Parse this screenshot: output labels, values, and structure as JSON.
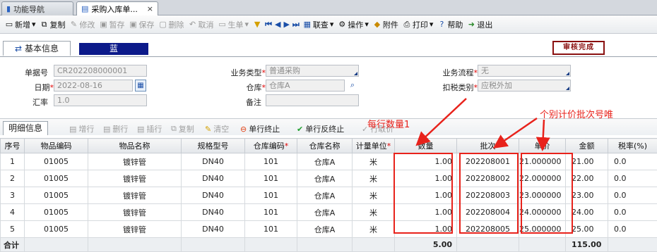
{
  "tabs": [
    {
      "label": "功能导航",
      "active": false
    },
    {
      "label": "采购入库单...",
      "active": true,
      "close": "×"
    }
  ],
  "toolbar": {
    "items": [
      {
        "label": "新增",
        "icon": "new-doc-icon",
        "enabled": true,
        "dropdown": true
      },
      {
        "label": "复制",
        "icon": "copy-icon",
        "enabled": true
      },
      {
        "label": "修改",
        "icon": "edit-icon",
        "enabled": false
      },
      {
        "label": "暂存",
        "icon": "save-draft-icon",
        "enabled": false
      },
      {
        "label": "保存",
        "icon": "save-icon",
        "enabled": false
      },
      {
        "label": "删除",
        "icon": "delete-icon",
        "enabled": false
      },
      {
        "label": "取消",
        "icon": "undo-icon",
        "enabled": false
      },
      {
        "label": "生单",
        "icon": "generate-doc-icon",
        "enabled": false,
        "dropdown": true
      }
    ],
    "right_items": [
      {
        "label": "联查",
        "icon": "link-query-icon",
        "dropdown": true
      },
      {
        "label": "操作",
        "icon": "gear-icon",
        "dropdown": true
      },
      {
        "label": "附件",
        "icon": "attachment-icon"
      },
      {
        "label": "打印",
        "icon": "printer-icon",
        "dropdown": true
      },
      {
        "label": "帮助",
        "icon": "help-icon"
      },
      {
        "label": "退出",
        "icon": "exit-icon"
      }
    ]
  },
  "info_tab": {
    "label": "基本信息"
  },
  "color_label": "蓝",
  "stamp": "审核完成",
  "form": {
    "doc_no": {
      "label": "单据号",
      "value": "CR202208000001"
    },
    "date": {
      "label": "日期",
      "value": "2022-08-16"
    },
    "rate": {
      "label": "汇率",
      "value": "1.0"
    },
    "biz_type": {
      "label": "业务类型",
      "value": "普通采购"
    },
    "warehouse": {
      "label": "仓库",
      "value": "仓库A"
    },
    "remark": {
      "label": "备注",
      "value": ""
    },
    "flow": {
      "label": "业务流程",
      "value": "无"
    },
    "tax": {
      "label": "扣税类别",
      "value": "应税外加"
    }
  },
  "detail": {
    "tab": "明细信息",
    "buttons": [
      {
        "label": "增行",
        "enabled": false
      },
      {
        "label": "删行",
        "enabled": false
      },
      {
        "label": "插行",
        "enabled": false
      },
      {
        "label": "复制",
        "enabled": false
      },
      {
        "label": "清空",
        "enabled": false
      },
      {
        "label": "单行终止",
        "enabled": true
      },
      {
        "label": "单行反终止",
        "enabled": true
      },
      {
        "label": "行取价",
        "enabled": false
      }
    ]
  },
  "grid": {
    "headers": [
      "序号",
      "物品编码",
      "物品名称",
      "规格型号",
      "仓库编码",
      "仓库名称",
      "计量单位",
      "数量",
      "批次",
      "单价",
      "金额",
      "税率(%)"
    ],
    "required": [
      false,
      false,
      false,
      false,
      true,
      false,
      true,
      false,
      false,
      false,
      false,
      false
    ],
    "rows": [
      [
        "1",
        "01005",
        "镀锌管",
        "DN40",
        "101",
        "仓库A",
        "米",
        "1.00",
        "202208001",
        "21.000000",
        "21.00",
        "0.0"
      ],
      [
        "2",
        "01005",
        "镀锌管",
        "DN40",
        "101",
        "仓库A",
        "米",
        "1.00",
        "202208002",
        "22.000000",
        "22.00",
        "0.0"
      ],
      [
        "3",
        "01005",
        "镀锌管",
        "DN40",
        "101",
        "仓库A",
        "米",
        "1.00",
        "202208003",
        "23.000000",
        "23.00",
        "0.0"
      ],
      [
        "4",
        "01005",
        "镀锌管",
        "DN40",
        "101",
        "仓库A",
        "米",
        "1.00",
        "202208004",
        "24.000000",
        "24.00",
        "0.0"
      ],
      [
        "5",
        "01005",
        "镀锌管",
        "DN40",
        "101",
        "仓库A",
        "米",
        "1.00",
        "202208005",
        "25.000000",
        "25.00",
        "0.0"
      ]
    ],
    "total": {
      "label": "合计",
      "qty": "5.00",
      "amount": "115.00"
    }
  },
  "annotations": {
    "qty_note": "每行数量1",
    "batch_note": "个别计价批次号唯"
  },
  "colors": {
    "annotation": "#e8221b",
    "accent": "#0c1a8a",
    "stamp": "#8a1010"
  }
}
